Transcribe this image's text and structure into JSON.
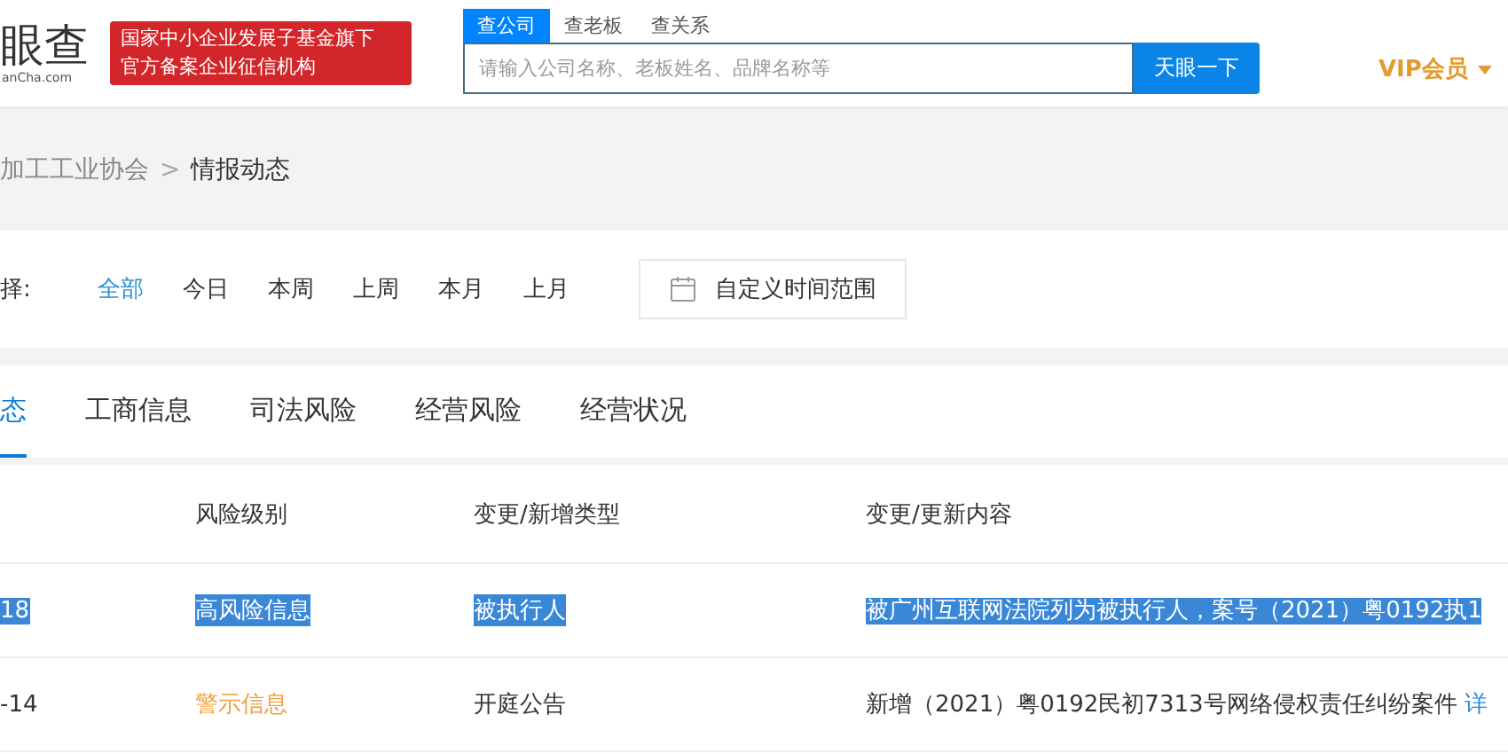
{
  "header": {
    "logo": "眼查",
    "logo_domain": "anCha.com",
    "badge_lines": [
      "国家中小企业发展子基金旗下",
      "官方备案企业征信机构"
    ],
    "search_tabs": [
      {
        "label": "查公司",
        "selected": true
      },
      {
        "label": "查老板",
        "selected": false
      },
      {
        "label": "查关系",
        "selected": false
      }
    ],
    "search": {
      "placeholder": "请输入公司名称、老板姓名、品牌名称等",
      "button": "天眼一下"
    },
    "vip": "VIP会员"
  },
  "breadcrumb": {
    "parent": "加工工业协会",
    "separator": ">",
    "current": "情报动态"
  },
  "filter": {
    "label": "择:",
    "options": [
      {
        "label": "全部",
        "selected": true
      },
      {
        "label": "今日",
        "selected": false
      },
      {
        "label": "本周",
        "selected": false
      },
      {
        "label": "上周",
        "selected": false
      },
      {
        "label": "本月",
        "selected": false
      },
      {
        "label": "上月",
        "selected": false
      }
    ],
    "custom_range": "自定义时间范围"
  },
  "tabs": [
    {
      "label": "态",
      "selected": true
    },
    {
      "label": "工商信息",
      "selected": false
    },
    {
      "label": "司法风险",
      "selected": false
    },
    {
      "label": "经营风险",
      "selected": false
    },
    {
      "label": "经营状况",
      "selected": false
    }
  ],
  "table": {
    "columns": [
      "风险级别",
      "变更/新增类型",
      "变更/更新内容"
    ],
    "rows": [
      {
        "selected": true,
        "date": "18",
        "level": "高风险信息",
        "kind": "high",
        "type": "被执行人",
        "content": "被广州互联网法院列为被执行人，案号（2021）粤0192执1"
      },
      {
        "selected": false,
        "date": "-14",
        "level": "警示信息",
        "kind": "warning",
        "type": "开庭公告",
        "content": "新增（2021）粤0192民初7313号网络侵权责任纠纷案件",
        "link": "详"
      }
    ]
  }
}
